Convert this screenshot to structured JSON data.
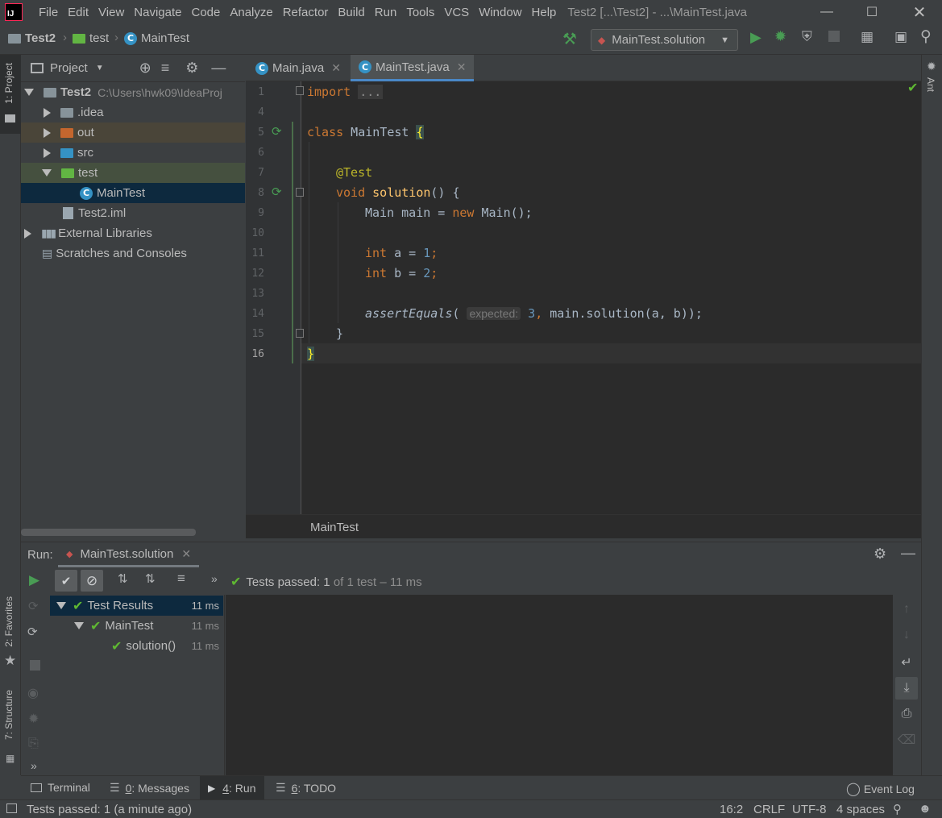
{
  "menu": {
    "items": [
      "File",
      "Edit",
      "View",
      "Navigate",
      "Code",
      "Analyze",
      "Refactor",
      "Build",
      "Run",
      "Tools",
      "VCS",
      "Window",
      "Help"
    ],
    "window_title": "Test2 [...\\Test2] - ...\\MainTest.java",
    "logo_text": "IJ"
  },
  "navbar": {
    "crumbs": [
      "Test2",
      "test",
      "MainTest"
    ],
    "run_config": "MainTest.solution"
  },
  "left_strip": {
    "project_tab": "1: Project",
    "favorites_tab": "2: Favorites",
    "structure_tab": "7: Structure"
  },
  "right_strip": {
    "ant_tab": "Ant"
  },
  "project": {
    "title": "Project",
    "root_name": "Test2",
    "root_path": "C:\\Users\\hwk09\\IdeaProj",
    "items": [
      ".idea",
      "out",
      "src",
      "test",
      "MainTest",
      "Test2.iml",
      "External Libraries",
      "Scratches and Consoles"
    ]
  },
  "editor": {
    "tabs": [
      "Main.java",
      "MainTest.java"
    ],
    "line_numbers": [
      "1",
      "4",
      "5",
      "6",
      "7",
      "8",
      "9",
      "10",
      "11",
      "12",
      "13",
      "14",
      "15",
      "16"
    ],
    "code": {
      "l1_kw": "import",
      "l1_fold": "...",
      "l5_kw": "class",
      "l5_name": " MainTest ",
      "l5_brace": "{",
      "l7_ann": "@Test",
      "l8_kw": "void",
      "l8_fn": " solution",
      "l8_rest": "() {",
      "l9_a": "Main main = ",
      "l9_kw": "new",
      "l9_b": " Main();",
      "l11_kw": "int",
      "l11_a": " a = ",
      "l11_num": "1",
      "l11_semi": ";",
      "l12_kw": "int",
      "l12_a": " b = ",
      "l12_num": "2",
      "l12_semi": ";",
      "l14_fn": "assertEquals",
      "l14_paren": "( ",
      "l14_hint": "expected:",
      "l14_num": " 3",
      "l14_comma": ",",
      "l14_rest": " main.solution(a, b));",
      "l15": "}",
      "l16": "}"
    },
    "breadcrumb": "MainTest"
  },
  "run": {
    "label": "Run:",
    "tab": "MainTest.solution",
    "status_prefix": "Tests passed:",
    "status_count": "1",
    "status_suffix": "of 1 test – 11 ms",
    "tree": [
      {
        "name": "Test Results",
        "time": "11 ms"
      },
      {
        "name": "MainTest",
        "time": "11 ms"
      },
      {
        "name": "solution()",
        "time": "11 ms"
      }
    ]
  },
  "bottom_tools": {
    "terminal": "Terminal",
    "messages_num": "0",
    "messages": ": Messages",
    "run_num": "4",
    "run": ": Run",
    "todo_num": "6",
    "todo": ": TODO",
    "event_log": "Event Log"
  },
  "status": {
    "message": "Tests passed: 1 (a minute ago)",
    "position": "16:2",
    "line_sep": "CRLF",
    "encoding": "UTF-8",
    "indent": "4 spaces"
  }
}
